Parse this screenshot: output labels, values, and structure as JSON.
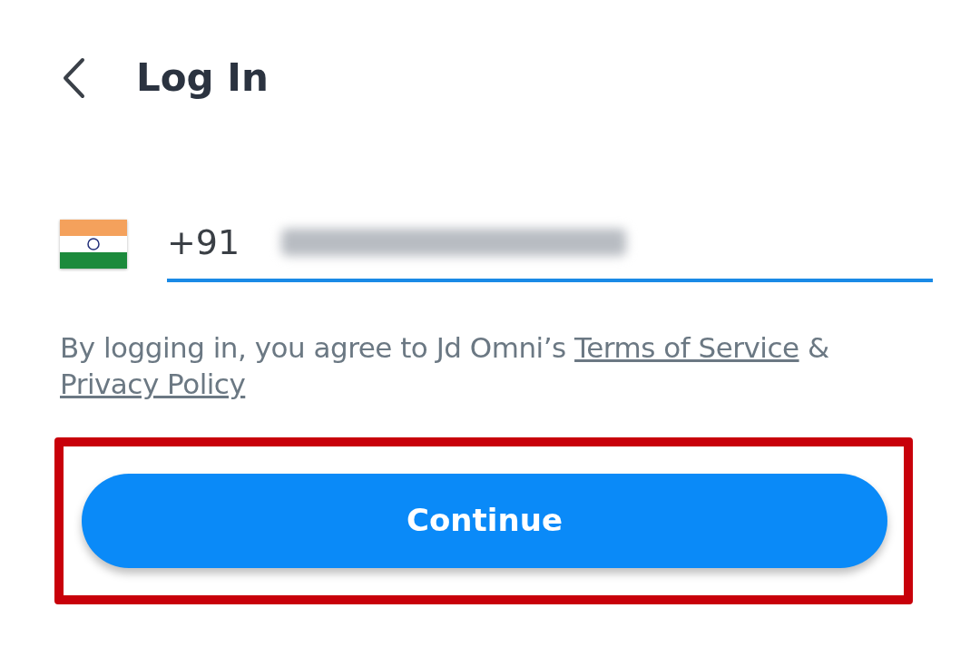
{
  "header": {
    "title": "Log In"
  },
  "phone": {
    "country_code": "+91",
    "value_redacted": true
  },
  "consent": {
    "text": "By logging in, you agree to Jd Omni’s ",
    "links": [
      "Terms of Service",
      "Privacy Policy"
    ],
    "joiner": " & "
  },
  "continue_button": {
    "label": "Continue",
    "highlighted": true
  }
}
